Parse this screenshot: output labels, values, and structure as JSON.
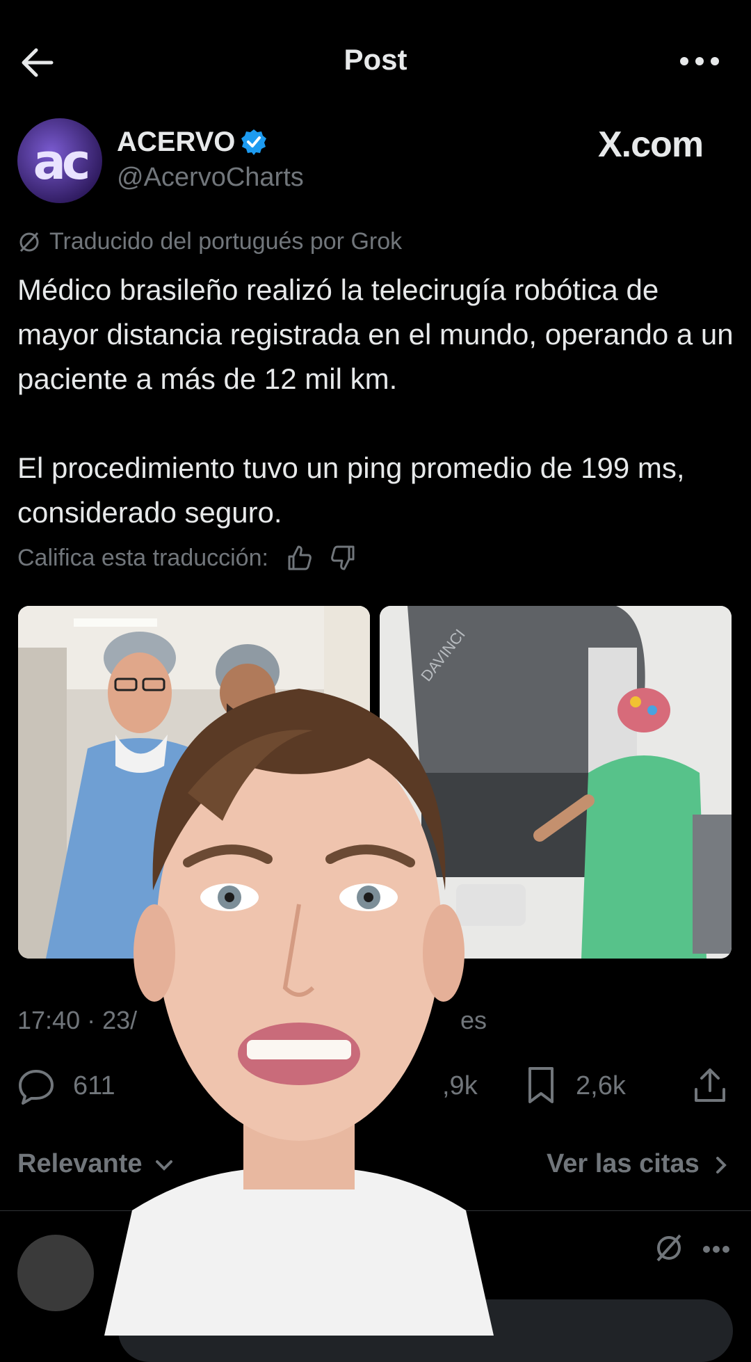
{
  "header": {
    "title": "Post"
  },
  "author": {
    "avatar_text": "ac",
    "name": "ACERVO",
    "handle": "@AcervoCharts",
    "watermark": "X.com"
  },
  "post": {
    "translation_note": "Traducido del portugués por Grok",
    "text": "Médico brasileño realizó la telecirugía robótica de mayor distancia registrada en el mundo, operando a un paciente a más de 12 mil km.\n\nEl procedimiento tuvo un ping promedio de 199 ms, considerado seguro.",
    "rate_label": "Califica esta traducción:",
    "robot_brand": "DAVINCI",
    "timestamp_visible": "17:40 · 23/",
    "timestamp_tail": "es"
  },
  "actions": {
    "replies": "611",
    "likes_visible": ",9k",
    "bookmarks": "2,6k"
  },
  "replies_bar": {
    "sort_label": "Relevante",
    "quotes_label": "Ver las citas"
  },
  "colors": {
    "background": "#000000",
    "text": "#e7e9ea",
    "muted": "#71767b",
    "verified": "#1d9bf0"
  }
}
